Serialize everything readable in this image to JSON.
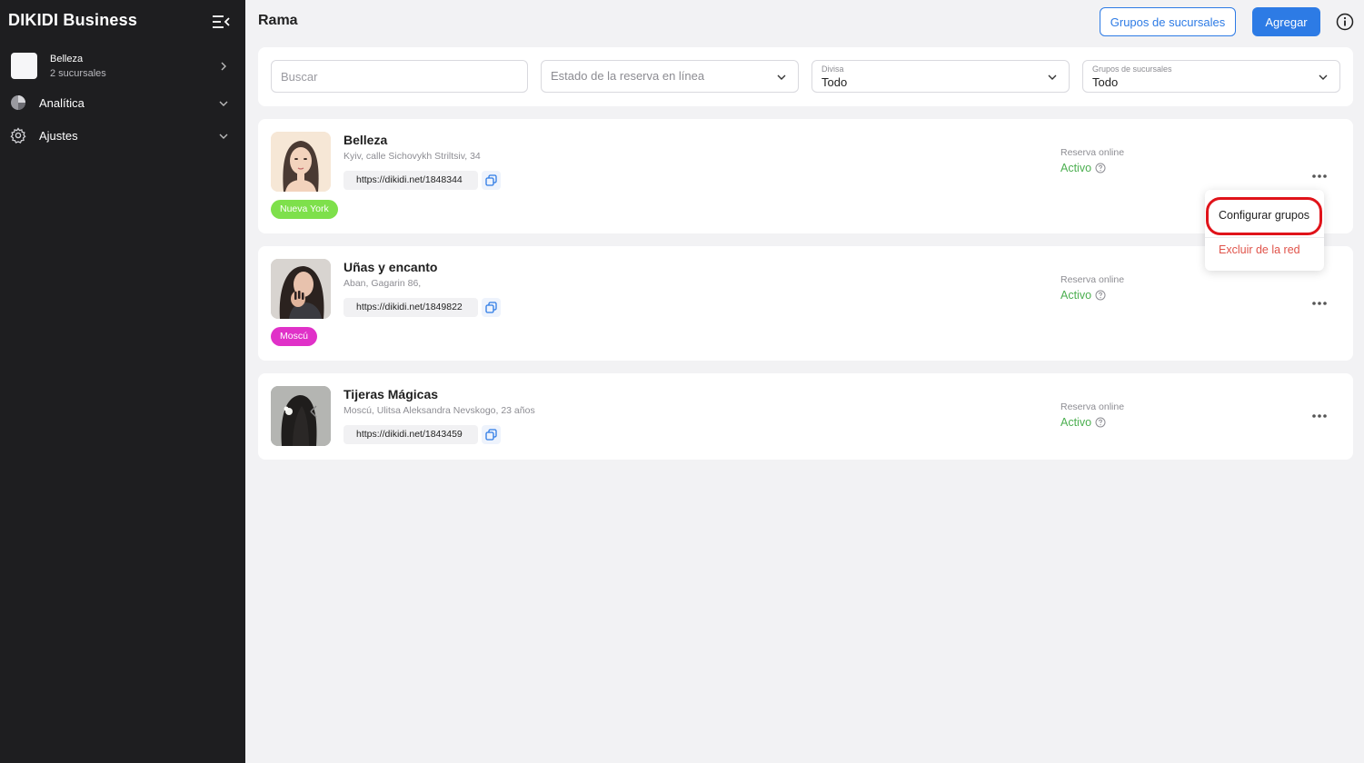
{
  "sidebar": {
    "brand": "DIKIDI Business",
    "account": {
      "name": "Belleza",
      "subtitle": "2 sucursales"
    },
    "items": [
      {
        "label": "Analítica",
        "icon": "pie-chart-icon"
      },
      {
        "label": "Ajustes",
        "icon": "gear-icon"
      }
    ]
  },
  "header": {
    "title": "Rama",
    "groups_button": "Grupos de sucursales",
    "add_button": "Agregar"
  },
  "filters": {
    "search_placeholder": "Buscar",
    "online_status_placeholder": "Estado de la reserva en línea",
    "currency": {
      "label": "Divisa",
      "value": "Todo"
    },
    "branch_groups": {
      "label": "Grupos de sucursales",
      "value": "Todo"
    }
  },
  "branches": [
    {
      "name": "Belleza",
      "address": "Kyiv, calle Sichovykh Striltsiv, 34",
      "link": "https://dikidi.net/1848344",
      "tag": "Nueva York",
      "tag_color": "#7ee04b",
      "online_label": "Reserva online",
      "online_status": "Activo"
    },
    {
      "name": "Uñas y encanto",
      "address": "Aban, Gagarin 86,",
      "link": "https://dikidi.net/1849822",
      "tag": "Moscú",
      "tag_color": "#e031c8",
      "online_label": "Reserva online",
      "online_status": "Activo"
    },
    {
      "name": "Tijeras Mágicas",
      "address": "Moscú, Ulitsa Aleksandra Nevskogo, 23 años",
      "link": "https://dikidi.net/1843459",
      "tag": "",
      "online_label": "Reserva online",
      "online_status": "Activo"
    }
  ],
  "context_menu": {
    "configure_groups": "Configurar grupos",
    "exclude": "Excluir de la red"
  },
  "colors": {
    "accent": "#2d7be5",
    "sidebar_bg": "#1e1e20",
    "active_status": "#4caf50",
    "danger": "#e0534a",
    "highlight_ring": "#e0131a"
  }
}
